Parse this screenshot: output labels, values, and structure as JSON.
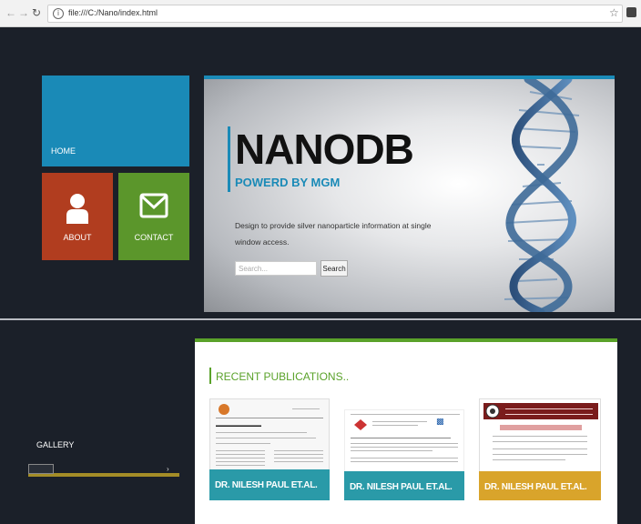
{
  "browser": {
    "url": "file:///C:/Nano/index.html",
    "back_icon": "arrow-left-icon",
    "forward_icon": "arrow-right-icon",
    "reload_icon": "reload-icon",
    "bookmark_icon": "star-icon"
  },
  "tiles": {
    "home": {
      "label": "HOME",
      "color": "#1a8ab7"
    },
    "about": {
      "label": "ABOUT",
      "icon": "person-icon",
      "color": "#b13d1f"
    },
    "contact": {
      "label": "CONTACT",
      "icon": "envelope-icon",
      "color": "#5b962b"
    }
  },
  "hero": {
    "title": "NANODB",
    "subtitle": "POWERD BY MGM",
    "description": "Design to provide silver nanoparticle information at single window access.",
    "search_placeholder": "Search...",
    "search_button": "Search",
    "image_icon": "dna-helix-icon"
  },
  "gallery": {
    "label": "GALLERY",
    "arrow": "›"
  },
  "publications": {
    "title": "RECENT PUBLICATIONS..",
    "items": [
      {
        "caption": "DR. NILESH PAUL ET.AL.",
        "color": "#2a9aa8"
      },
      {
        "caption": "DR. NILESH PAUL ET.AL.",
        "color": "#2a9aa8"
      },
      {
        "caption": "DR. NILESH PAUL ET.AL.",
        "color": "#d9a42b"
      }
    ]
  }
}
